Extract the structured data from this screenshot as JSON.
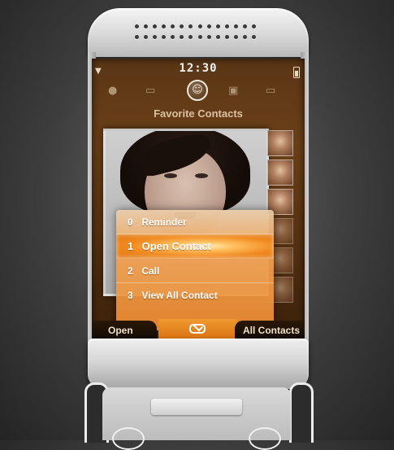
{
  "status": {
    "time": "12:30",
    "signal_icon": "signal-icon",
    "battery_icon": "battery-icon"
  },
  "header": {
    "title": "Favorite Contacts",
    "app_icons": [
      "messages-icon",
      "folder-icon",
      "smiley-icon",
      "camera-icon",
      "mail-icon"
    ]
  },
  "menu": {
    "items": [
      {
        "number": "0",
        "label": "Reminder"
      },
      {
        "number": "1",
        "label": "Open Contact"
      },
      {
        "number": "2",
        "label": "Call"
      },
      {
        "number": "3",
        "label": "View All Contact"
      }
    ],
    "selected_index": 1
  },
  "softkeys": {
    "left": "Open",
    "center_icon": "envelope-icon",
    "right": "All Contacts"
  },
  "colors": {
    "accent_orange": "#f08a20",
    "screen_bg": "#5a3616",
    "text_light": "#f0e0c8"
  }
}
